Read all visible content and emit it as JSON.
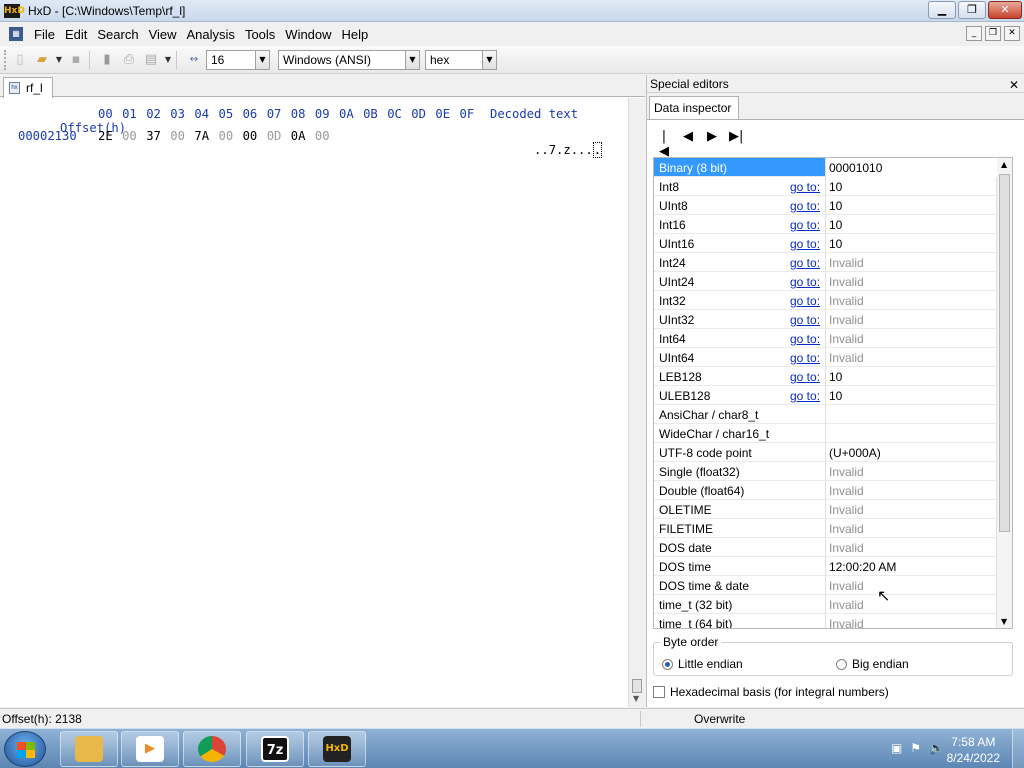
{
  "window": {
    "app_icon": "HxD",
    "title": "HxD - [C:\\Windows\\Temp\\rf_l]",
    "buttons": {
      "minimize": "▁",
      "maximize": "❐",
      "close": "✕"
    }
  },
  "menu": {
    "icon": "hex-doc-icon",
    "items": [
      "File",
      "Edit",
      "Search",
      "View",
      "Analysis",
      "Tools",
      "Window",
      "Help"
    ],
    "mdi_buttons": {
      "minimize": "_",
      "restore": "❐",
      "close": "✕"
    }
  },
  "toolbar": {
    "bytes_per_row": "16",
    "charset": "Windows (ANSI)",
    "offset_base": "hex"
  },
  "document": {
    "tab_label": "rf_l",
    "header_offset": "Offset(h)",
    "header_bytes": [
      "00",
      "01",
      "02",
      "03",
      "04",
      "05",
      "06",
      "07",
      "08",
      "09",
      "0A",
      "0B",
      "0C",
      "0D",
      "0E",
      "0F"
    ],
    "header_decoded": "Decoded text",
    "rows": [
      {
        "offset": "00002130",
        "bytes": [
          "2E",
          "00",
          "37",
          "00",
          "7A",
          "00",
          "00",
          "0D",
          "0A",
          "00"
        ],
        "dim": [
          false,
          true,
          false,
          true,
          false,
          true,
          false,
          true,
          false,
          true
        ],
        "decoded": "..7.z...",
        "decoded_cursor": "."
      }
    ]
  },
  "panel": {
    "title": "Special editors",
    "tab": "Data inspector",
    "nav": [
      "|◀",
      "◀",
      "▶",
      "▶|"
    ],
    "goto_label": "go to:",
    "rows": [
      {
        "name": "Binary (8 bit)",
        "value": "00001010",
        "goto": false,
        "invalid": false,
        "selected": true
      },
      {
        "name": "Int8",
        "value": "10",
        "goto": true,
        "invalid": false
      },
      {
        "name": "UInt8",
        "value": "10",
        "goto": true,
        "invalid": false
      },
      {
        "name": "Int16",
        "value": "10",
        "goto": true,
        "invalid": false
      },
      {
        "name": "UInt16",
        "value": "10",
        "goto": true,
        "invalid": false
      },
      {
        "name": "Int24",
        "value": "Invalid",
        "goto": true,
        "invalid": true
      },
      {
        "name": "UInt24",
        "value": "Invalid",
        "goto": true,
        "invalid": true
      },
      {
        "name": "Int32",
        "value": "Invalid",
        "goto": true,
        "invalid": true
      },
      {
        "name": "UInt32",
        "value": "Invalid",
        "goto": true,
        "invalid": true
      },
      {
        "name": "Int64",
        "value": "Invalid",
        "goto": true,
        "invalid": true
      },
      {
        "name": "UInt64",
        "value": "Invalid",
        "goto": true,
        "invalid": true
      },
      {
        "name": "LEB128",
        "value": "10",
        "goto": true,
        "invalid": false
      },
      {
        "name": "ULEB128",
        "value": "10",
        "goto": true,
        "invalid": false
      },
      {
        "name": "AnsiChar / char8_t",
        "value": "",
        "goto": false,
        "invalid": false
      },
      {
        "name": "WideChar / char16_t",
        "value": "",
        "goto": false,
        "invalid": false
      },
      {
        "name": "UTF-8 code point",
        "value": " (U+000A)",
        "goto": false,
        "invalid": false
      },
      {
        "name": "Single (float32)",
        "value": "Invalid",
        "goto": false,
        "invalid": true
      },
      {
        "name": "Double (float64)",
        "value": "Invalid",
        "goto": false,
        "invalid": true
      },
      {
        "name": "OLETIME",
        "value": "Invalid",
        "goto": false,
        "invalid": true
      },
      {
        "name": "FILETIME",
        "value": "Invalid",
        "goto": false,
        "invalid": true
      },
      {
        "name": "DOS date",
        "value": "Invalid",
        "goto": false,
        "invalid": true
      },
      {
        "name": "DOS time",
        "value": "12:00:20 AM",
        "goto": false,
        "invalid": false
      },
      {
        "name": "DOS time & date",
        "value": "Invalid",
        "goto": false,
        "invalid": true
      },
      {
        "name": "time_t (32 bit)",
        "value": "Invalid",
        "goto": false,
        "invalid": true
      },
      {
        "name": "time_t (64 bit)",
        "value": "Invalid",
        "goto": false,
        "invalid": true
      }
    ],
    "byte_order": {
      "legend": "Byte order",
      "options": [
        {
          "label": "Little endian",
          "selected": true
        },
        {
          "label": "Big endian",
          "selected": false
        }
      ]
    },
    "hex_basis": {
      "label": "Hexadecimal basis (for integral numbers)",
      "checked": false
    }
  },
  "status": {
    "offset": "Offset(h): 2138",
    "mode": "Overwrite"
  },
  "taskbar": {
    "apps": [
      {
        "name": "explorer-icon",
        "glyph": "",
        "color": "#e8b84a"
      },
      {
        "name": "media-player-icon",
        "glyph": "▶",
        "color": "#f08a24"
      },
      {
        "name": "chrome-icon",
        "glyph": "",
        "color": "#db4437"
      },
      {
        "name": "7zip-icon",
        "glyph": "7z",
        "color": "#ffffff"
      },
      {
        "name": "hxd-icon",
        "glyph": "HxD",
        "color": "#f4b400"
      }
    ],
    "time": "7:58 AM",
    "date": "8/24/2022"
  }
}
